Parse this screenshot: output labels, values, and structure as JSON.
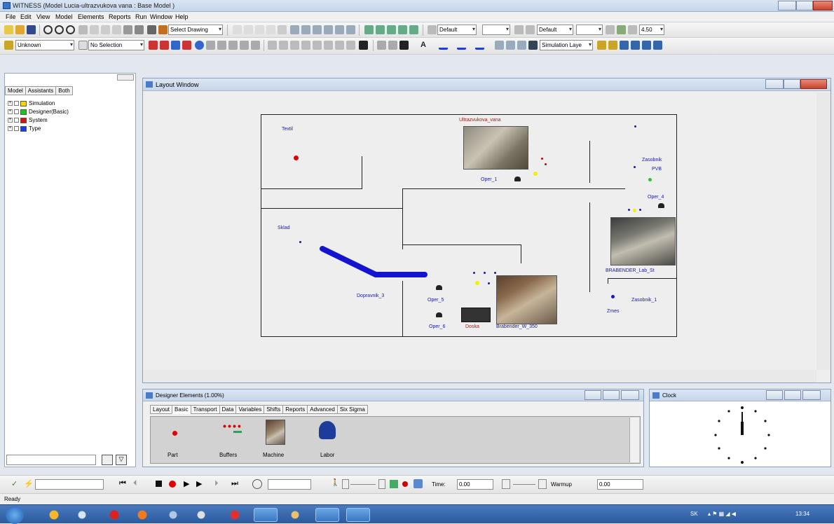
{
  "window": {
    "title": "WITNESS (Model Lucia-ultrazvukova vana : Base Model )"
  },
  "menu": [
    "File",
    "Edit",
    "View",
    "Model",
    "Elements",
    "Reports",
    "Run",
    "Window",
    "Help"
  ],
  "toolbar1": {
    "drawing_select": "Select Drawing",
    "default_left": "Default",
    "default_right": "Default",
    "zoom_value": "4.50"
  },
  "toolbar2": {
    "unknown_select": "Unknown",
    "no_selection": "No Selection",
    "simulation_layer": "Simulation Laye"
  },
  "left_panel": {
    "tabs": [
      "Model",
      "Assistants",
      "Both"
    ],
    "tree": [
      {
        "label": "Simulation",
        "color": "#f2d800"
      },
      {
        "label": "Designer(Basic)",
        "color": "#22c022"
      },
      {
        "label": "System",
        "color": "#d41414"
      },
      {
        "label": "Type",
        "color": "#1a3ed8"
      }
    ]
  },
  "layout_window": {
    "title": "Layout Window",
    "labels": {
      "textil": "Textil",
      "ultrazvukova": "Ultrazvukova_vana",
      "oper1": "Oper_1",
      "zasobnik_pvb_1": "Zasobnik",
      "zasobnik_pvb_2": "PVB",
      "oper4": "Oper_4",
      "sklad": "Sklad",
      "brabender_lab": "BRABENDER_Lab_St",
      "dopravnik": "Dopravnik_3",
      "oper5": "Oper_5",
      "oper6": "Oper_6",
      "doska": "Doska",
      "brabender_w": "Brabender_W_350",
      "zasobnik1": "Zasobnik_1",
      "zmes": "Zmes"
    }
  },
  "designer_elements": {
    "title": "Designer Elements (1.00%)",
    "tabs": [
      "Layout",
      "Basic",
      "Transport",
      "Data",
      "Variables",
      "Shifts",
      "Reports",
      "Advanced",
      "Six Sigma"
    ],
    "items": [
      "Part",
      "Buffers",
      "Machine",
      "Labor"
    ]
  },
  "clock": {
    "title": "Clock"
  },
  "runbar": {
    "time_label": "Time:",
    "time_value": "0.00",
    "warmup_label": "Warmup",
    "warmup_value": "0.00"
  },
  "status": {
    "text": "Ready"
  },
  "taskbar": {
    "lang": "SK",
    "time": "13:34"
  }
}
